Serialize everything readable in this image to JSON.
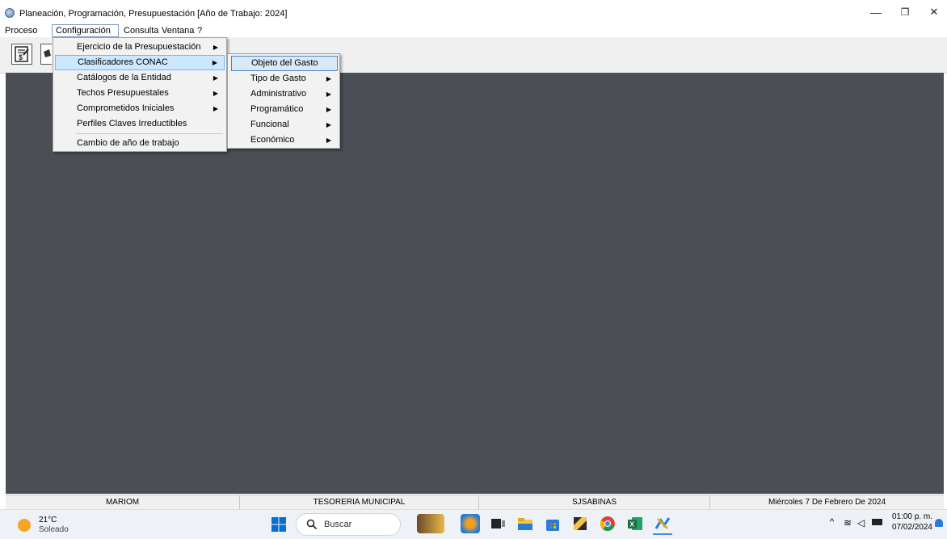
{
  "window": {
    "title": "Planeación, Programación, Presupuestación [Año de Trabajo: 2024]",
    "minimize": "—",
    "restore": "❐",
    "close": "✕"
  },
  "menubar": {
    "items": [
      "Proceso",
      "Configuración",
      "Consulta",
      "Ventana",
      "?"
    ]
  },
  "config_menu": {
    "items": [
      "Ejercicio de la Presupuestación",
      "Clasificadores CONAC",
      "Catálogos de la Entidad",
      "Techos Presupuestales",
      "Comprometidos Iniciales",
      "Perfiles Claves Irreductibles",
      "Cambio de año de trabajo"
    ]
  },
  "conac_submenu": {
    "items": [
      "Objeto del Gasto",
      "Tipo de Gasto",
      "Administrativo",
      "Programático",
      "Funcional",
      "Económico"
    ]
  },
  "statusbar": {
    "user": "MARIOM",
    "department": "TESORERIA MUNICIPAL",
    "server": "SJSABINAS",
    "date": "Miércoles 7 De Febrero De 2024"
  },
  "taskbar": {
    "weather_temp": "21°C",
    "weather_desc": "Soleado",
    "search_placeholder": "Buscar",
    "time": "01:00 p. m.",
    "date": "07/02/2024",
    "colors": {
      "start": "#0a6ed1",
      "sun": "#f5a623",
      "excel": "#1d7044",
      "chrome": "#db4437"
    }
  }
}
